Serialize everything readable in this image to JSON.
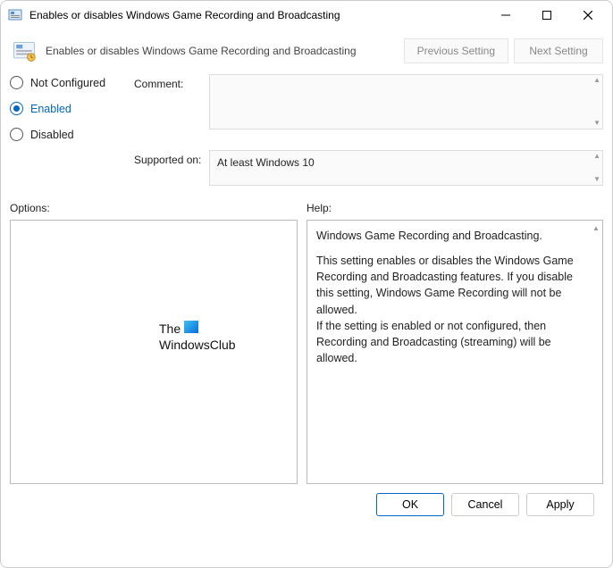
{
  "window": {
    "title": "Enables or disables Windows Game Recording and Broadcasting"
  },
  "header": {
    "title": "Enables or disables Windows Game Recording and Broadcasting",
    "prev_label": "Previous Setting",
    "next_label": "Next Setting"
  },
  "state": {
    "options": [
      "Not Configured",
      "Enabled",
      "Disabled"
    ],
    "selected_index": 1,
    "comment_label": "Comment:",
    "comment_value": "",
    "supported_label": "Supported on:",
    "supported_value": "At least Windows 10"
  },
  "sections": {
    "options_label": "Options:",
    "help_label": "Help:"
  },
  "help": {
    "p1": "Windows Game Recording and Broadcasting.",
    "p2": "This setting enables or disables the Windows Game Recording and Broadcasting features. If you disable this setting, Windows Game Recording will not be allowed.",
    "p3": "If the setting is enabled or not configured, then Recording and Broadcasting (streaming) will be allowed."
  },
  "watermark": {
    "line1": "The",
    "line2": "WindowsClub"
  },
  "footer": {
    "ok": "OK",
    "cancel": "Cancel",
    "apply": "Apply"
  }
}
